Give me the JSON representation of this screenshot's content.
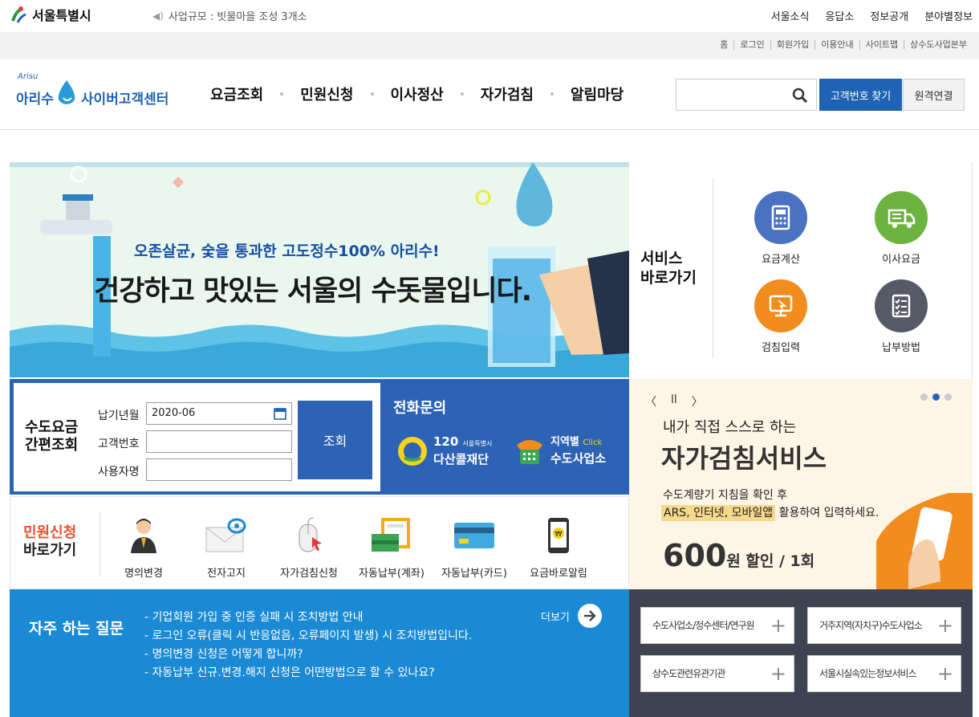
{
  "topbar": {
    "seoul_logo": "서울특별시",
    "notice": "사업규모 : 빗물마을 조성 3개소",
    "menu": [
      "서울소식",
      "응답소",
      "정보공개",
      "분야별정보"
    ]
  },
  "utilbar": {
    "menu": [
      "홈",
      "로그인",
      "회원가입",
      "이용안내",
      "사이트맵",
      "상수도사업본부"
    ]
  },
  "header": {
    "logo_small": "Arisu",
    "logo_main": "아리수",
    "logo_sub": "사이버고객센터",
    "gnb": [
      "요금조회",
      "민원신청",
      "이사정산",
      "자가검침",
      "알림마당"
    ],
    "search": {
      "value": "",
      "placeholder": ""
    },
    "btn_customer": "고객번호 찾기",
    "btn_remote": "원격연결"
  },
  "banner": {
    "sub": "오존살균, 숯을 통과한 고도정수100% 아리수!",
    "main": "건강하고 맛있는 서울의 수돗물입니다."
  },
  "services": {
    "title_line1": "서비스",
    "title_line2": "바로가기",
    "items": [
      {
        "label": "요금계산",
        "color": "#4a72c0"
      },
      {
        "label": "이사요금",
        "color": "#6db33f"
      },
      {
        "label": "검침입력",
        "color": "#f08d1e"
      },
      {
        "label": "납부방법",
        "color": "#555a66"
      }
    ]
  },
  "quick": {
    "title_line1": "수도요금",
    "title_line2": "간편조회",
    "label_month": "납기년월",
    "value_month": "2020-06",
    "label_customer": "고객번호",
    "label_user": "사용자명",
    "btn": "조회",
    "phone_title": "전화문의",
    "dasan_num": "120",
    "dasan_small": "서울특별시",
    "dasan_name": "다산콜재단",
    "region_label": "지역별",
    "region_click": "Click",
    "region_name": "수도사업소"
  },
  "minwon": {
    "title_line1": "민원신청",
    "title_line2": "바로가기",
    "items": [
      "명의변경",
      "전자고지",
      "자가검침신청",
      "자동납부(계좌)",
      "자동납부(카드)",
      "요금바로알림"
    ]
  },
  "self": {
    "ctrl_prev": "〈",
    "ctrl_pause": "ll",
    "ctrl_next": "〉",
    "sub": "내가 직접 스스로 하는",
    "title": "자가검침서비스",
    "desc1": "수도계량기 지침을 확인 후",
    "desc2_hl": "ARS, 인터넷, 모바일앱",
    "desc2_rest": " 활용하여 입력하세요.",
    "price": "600",
    "price_unit": "원 할인 / 1회"
  },
  "faq": {
    "title": "자주 하는 질문",
    "more": "더보기",
    "items": [
      "- 기업회원 가입 중 인증 실패 시 조치방법 안내",
      "- 로그인 오류(클릭 시 반응없음, 오류페이지 발생) 시 조치방법입니다.",
      "- 명의변경 신청은 어떻게 합니까?",
      "- 자동납부 신규.변경.해지 신청은 어떤방법으로 할 수 있나요?"
    ]
  },
  "links": [
    "수도사업소/정수센터/연구원",
    "거주지역(자치구)수도사업소",
    "상수도관련유관기관",
    "서울시실속있는정보서비스"
  ]
}
